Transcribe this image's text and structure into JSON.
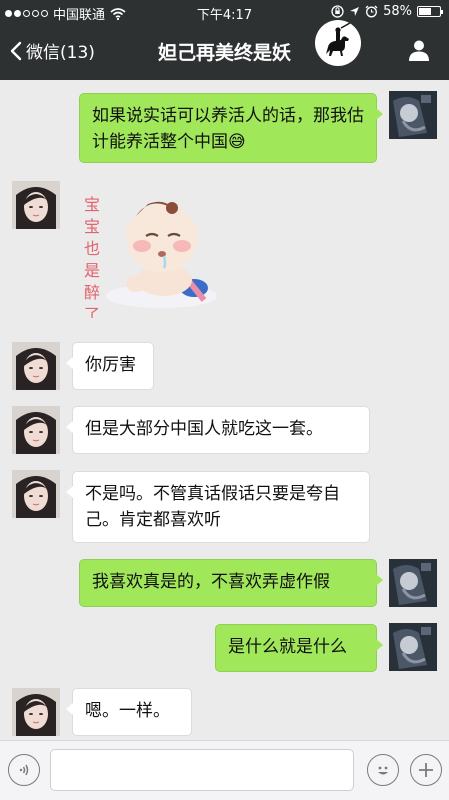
{
  "status_bar": {
    "carrier": "中国联通",
    "time": "下午4:17",
    "battery": "58%",
    "battery_level": 0.58
  },
  "nav": {
    "back_label": "微信(13)",
    "title": "妲己再美终是妖"
  },
  "messages": [
    {
      "from": "me",
      "text": "如果说实话可以养活人的话，那我估计能养活整个中国😅"
    },
    {
      "from": "her",
      "type": "sticker",
      "sticker_text": "宝宝也是醉了"
    },
    {
      "from": "her",
      "text": "你厉害"
    },
    {
      "from": "her",
      "text": "但是大部分中国人就吃这一套。"
    },
    {
      "from": "her",
      "text": "不是吗。不管真话假话只要是夸自己。肯定都喜欢听"
    },
    {
      "from": "me",
      "text": "我喜欢真是的，不喜欢弄虚作假"
    },
    {
      "from": "me",
      "text": "是什么就是什么"
    },
    {
      "from": "her",
      "text": "嗯。一样。"
    }
  ],
  "input": {
    "value": "",
    "placeholder": ""
  },
  "colors": {
    "bar_background": "#2e3132",
    "chat_background": "#ebebeb",
    "my_bubble": "#a0e75a",
    "their_bubble": "#ffffff"
  },
  "icons": [
    "wifi-icon",
    "rotation-lock-icon",
    "location-icon",
    "alarm-icon",
    "battery-icon",
    "back-chevron-icon",
    "person-icon",
    "voice-icon",
    "emoji-icon",
    "plus-icon"
  ]
}
